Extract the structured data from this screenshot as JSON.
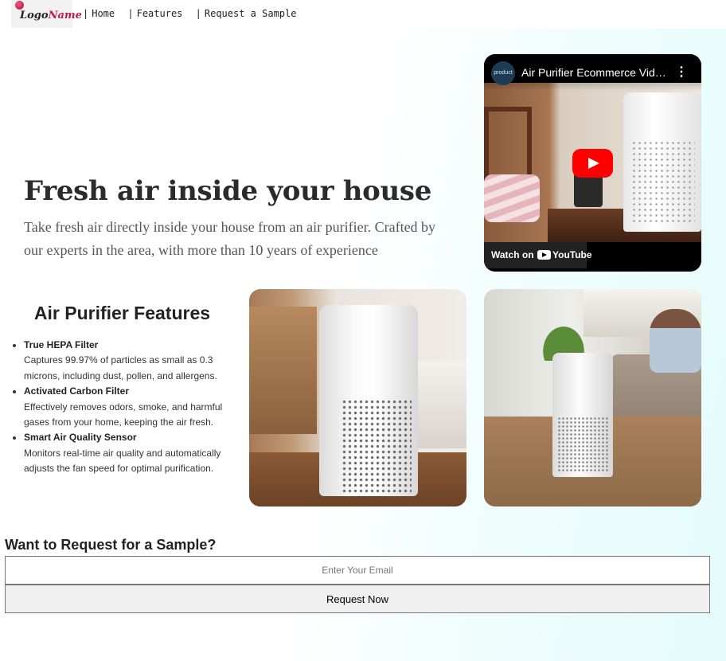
{
  "nav": {
    "logo_text_main": "Logo",
    "logo_text_accent": "Name",
    "links": [
      {
        "label": "Home"
      },
      {
        "label": "Features"
      },
      {
        "label": "Request a Sample"
      }
    ]
  },
  "hero": {
    "title": "Fresh air inside your house",
    "subtitle": "Take fresh air directly inside your house from an air purifier. Crafted by our experts in the area, with more than 10 years of experience"
  },
  "video": {
    "title": "Air Purifier Ecommerce Vide...",
    "channel_avatar_text": "product",
    "watch_on": "Watch on",
    "platform": "YouTube",
    "menu_icon": "more-vertical-icon",
    "play_icon": "youtube-play-icon"
  },
  "features": {
    "title": "Air Purifier Features",
    "items": [
      {
        "name": "True HEPA Filter",
        "description": "Captures 99.97% of particles as small as 0.3 microns, including dust, pollen, and allergens."
      },
      {
        "name": "Activated Carbon Filter",
        "description": "Effectively removes odors, smoke, and harmful gases from your home, keeping the air fresh."
      },
      {
        "name": "Smart Air Quality Sensor",
        "description": "Monitors real-time air quality and automatically adjusts the fan speed for optimal purification."
      }
    ]
  },
  "sample": {
    "title": "Want to Request for a Sample?",
    "email_placeholder": "Enter Your Email",
    "email_value": "",
    "button_label": "Request Now"
  },
  "colors": {
    "logo_accent": "#c2184b",
    "youtube_red": "#ff0000",
    "background_tint": "#e4fcfc"
  }
}
